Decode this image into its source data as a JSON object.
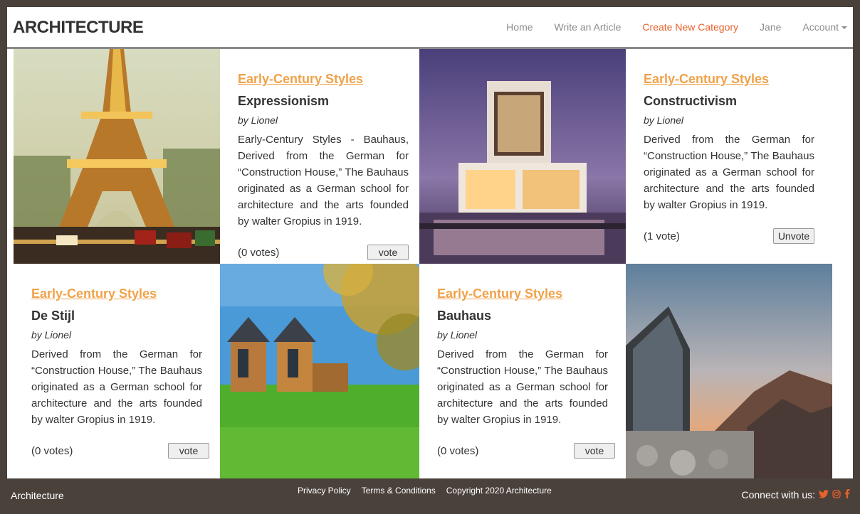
{
  "navbar": {
    "brand": "ARCHITECTURE",
    "links": [
      "Home",
      "Write an Article",
      "Create New Category",
      "Jane",
      "Account"
    ]
  },
  "articles": [
    {
      "category": "Early-Century Styles",
      "title": "Expressionism",
      "author": "by Lionel",
      "body": "Early-Century Styles - Bauhaus, Derived from the German for “Construction House,” The Bauhaus originated as a German school for architecture and the arts founded by walter Gropius in 1919.",
      "votes": "(0 votes)",
      "button": "vote"
    },
    {
      "category": "Early-Century Styles",
      "title": "Constructivism",
      "author": "by Lionel",
      "body": "Derived from the German for “Construction House,” The Bauhaus originated as a German school for architecture and the arts founded by walter Gropius in 1919.",
      "votes": "(1 vote)",
      "button": "Unvote"
    },
    {
      "category": "Early-Century Styles",
      "title": "De Stijl",
      "author": "by Lionel",
      "body": "Derived from the German for “Construction House,” The Bauhaus originated as a German school for architecture and the arts founded by walter Gropius in 1919.",
      "votes": "(0 votes)",
      "button": "vote"
    },
    {
      "category": "Early-Century Styles",
      "title": "Bauhaus",
      "author": "by Lionel",
      "body": "Derived from the German for “Construction House,” The Bauhaus originated as a German school for architecture and the arts founded by walter Gropius in 1919.",
      "votes": "(0 votes)",
      "button": "vote"
    }
  ],
  "footer": {
    "brand": "Architecture",
    "links": [
      "Privacy Policy",
      "Terms & Conditions",
      "Copyright 2020 Architecture"
    ],
    "connect": "Connect with us:",
    "social_icons": [
      "twitter-icon",
      "instagram-icon",
      "facebook-icon"
    ]
  },
  "colors": {
    "accent": "#e8612c",
    "category": "#f0a24a",
    "footer_bg": "#4a413b"
  }
}
